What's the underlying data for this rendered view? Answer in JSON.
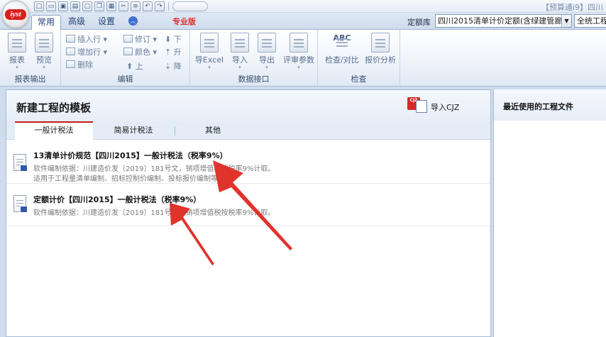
{
  "logo": {
    "text": "iyst"
  },
  "app_title": "【预算通i9】四川",
  "tabs": [
    {
      "label": "常用",
      "active": true
    },
    {
      "label": "高级",
      "active": false
    },
    {
      "label": "设置",
      "active": false
    }
  ],
  "pro_label": "专业版",
  "quota": {
    "label": "定额库",
    "selected": "四川2015清单计价定额(含绿建管廊)",
    "selected2": "全统工程"
  },
  "ribbon": {
    "report_group": {
      "label": "报表输出",
      "report": "报表",
      "preview": "预览"
    },
    "edit_group": {
      "label": "编辑",
      "insert_row": "插入行",
      "add_row": "增加行",
      "delete": "删除",
      "revise": "修订",
      "color": "颜色",
      "up": "上",
      "down": "下",
      "ascend": "升",
      "descend": "降"
    },
    "data_group": {
      "label": "数据接口",
      "import_excel": "导Excel",
      "import": "导入",
      "export": "导出",
      "review_params": "评审参数"
    },
    "check_group": {
      "label": "检查",
      "check_compare": "检查/对比",
      "price_analysis": "报价分析",
      "abc": "ABC"
    }
  },
  "panel": {
    "title": "新建工程的模板",
    "import_label": "导入CJZ",
    "cjz_badge": "CJZ",
    "subtabs": [
      "一般计税法",
      "简易计税法",
      "其他"
    ],
    "items": [
      {
        "title": "13清单计价规范【四川2015】一般计税法（税率9%）",
        "desc1": "软件编制依据：川建造价发〔2019〕181号文，销项增值税按税率9%计取。",
        "desc2": "适用于工程量清单编制、招标控制价编制、投标报价编制等"
      },
      {
        "title": "定额计价【四川2015】一般计税法（税率9%）",
        "desc1": "软件编制依据：川建造价发〔2019〕181号文，销项增值税按税率9%计取。"
      }
    ]
  },
  "recent": {
    "title": "最近使用的工程文件"
  },
  "colors": {
    "accent_red": "#e0332b",
    "tab_blue": "#1e3f72"
  }
}
